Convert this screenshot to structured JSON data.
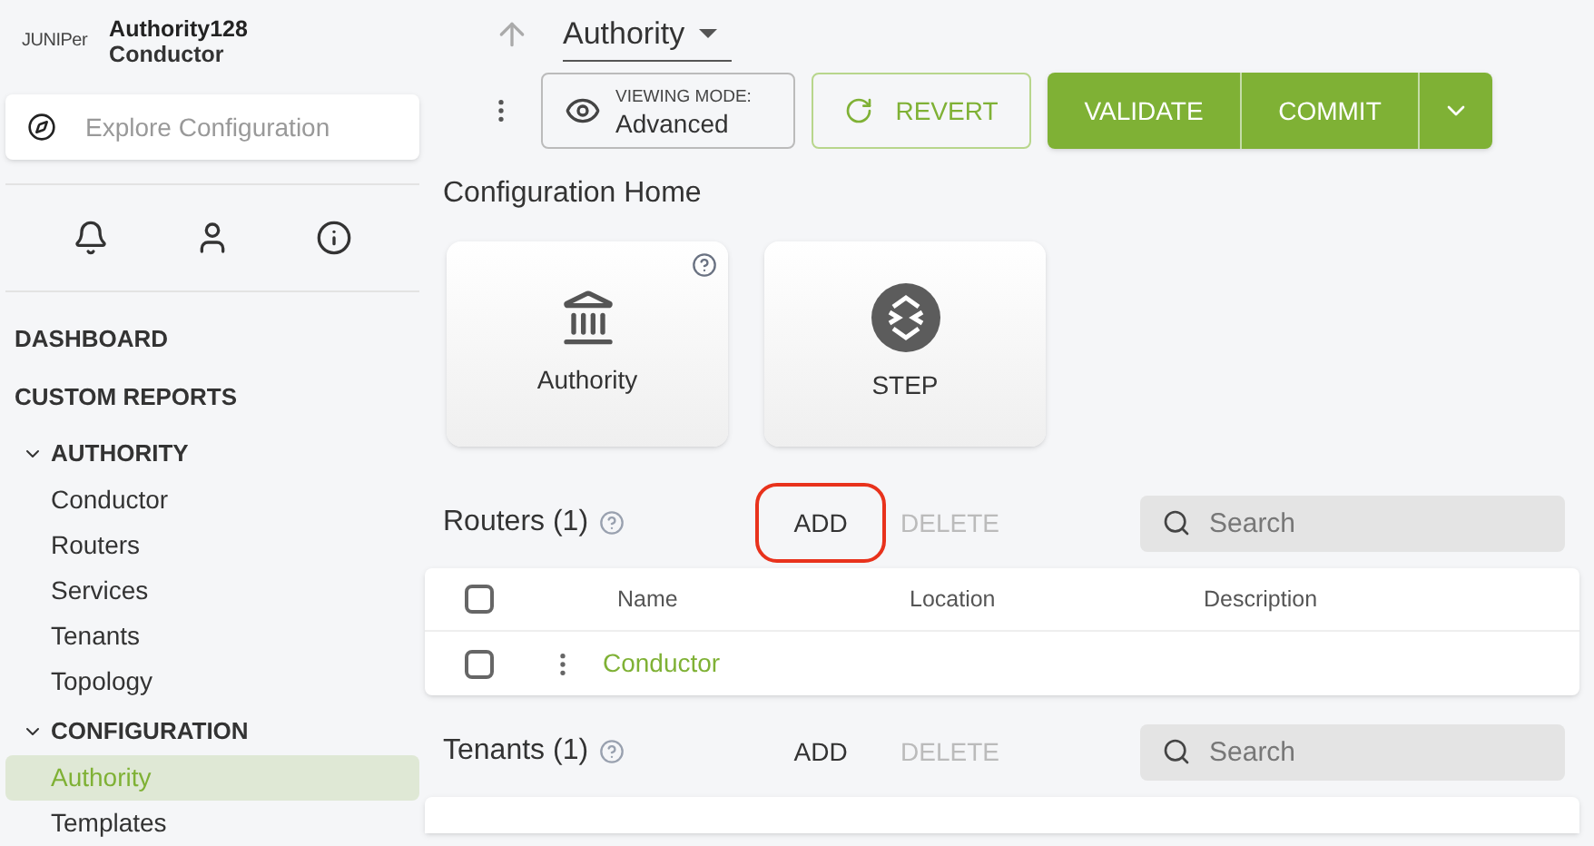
{
  "brand": {
    "logo": "JUNIPer",
    "title": "Authority128",
    "subtitle": "Conductor"
  },
  "explore": {
    "placeholder": "Explore Configuration"
  },
  "nav": [
    {
      "kind": "top",
      "label": "DASHBOARD"
    },
    {
      "kind": "top",
      "label": "CUSTOM REPORTS"
    },
    {
      "kind": "group",
      "label": "AUTHORITY",
      "expanded": true,
      "children": [
        {
          "label": "Conductor",
          "selected": false
        },
        {
          "label": "Routers",
          "selected": false
        },
        {
          "label": "Services",
          "selected": false
        },
        {
          "label": "Tenants",
          "selected": false
        },
        {
          "label": "Topology",
          "selected": false
        }
      ]
    },
    {
      "kind": "group",
      "label": "CONFIGURATION",
      "expanded": true,
      "children": [
        {
          "label": "Authority",
          "selected": true
        },
        {
          "label": "Templates",
          "selected": false
        }
      ]
    }
  ],
  "breadcrumb": "Authority",
  "viewing_mode": {
    "label": "VIEWING MODE:",
    "value": "Advanced"
  },
  "actions": {
    "revert": "REVERT",
    "validate": "VALIDATE",
    "commit": "COMMIT"
  },
  "home": {
    "title": "Configuration Home",
    "tiles": [
      {
        "kind": "authority",
        "label": "Authority",
        "help": true
      },
      {
        "kind": "step",
        "label": "STEP",
        "help": false
      }
    ]
  },
  "sections": [
    {
      "title": "Routers (1)",
      "add": "ADD",
      "add_highlighted": true,
      "delete": "DELETE",
      "search": {
        "placeholder": "Search"
      },
      "all_checked": false,
      "columns": [
        "Name",
        "Location",
        "Description"
      ],
      "rows": [
        {
          "name": "Conductor",
          "checked": false
        }
      ]
    },
    {
      "title": "Tenants (1)",
      "add": "ADD",
      "add_highlighted": false,
      "delete": "DELETE",
      "search": {
        "placeholder": "Search"
      }
    }
  ]
}
